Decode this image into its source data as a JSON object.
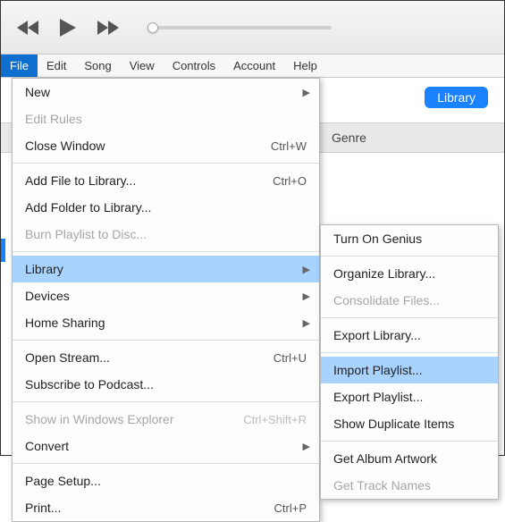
{
  "menubar": {
    "items": [
      "File",
      "Edit",
      "Song",
      "View",
      "Controls",
      "Account",
      "Help"
    ],
    "active_index": 0
  },
  "library_chip": "Library",
  "column_header": "Genre",
  "file_menu": {
    "groups": [
      [
        {
          "label": "New",
          "submenu": true
        },
        {
          "label": "Edit Rules",
          "disabled": true
        },
        {
          "label": "Close Window",
          "shortcut": "Ctrl+W"
        }
      ],
      [
        {
          "label": "Add File to Library...",
          "shortcut": "Ctrl+O"
        },
        {
          "label": "Add Folder to Library..."
        },
        {
          "label": "Burn Playlist to Disc...",
          "disabled": true
        }
      ],
      [
        {
          "label": "Library",
          "submenu": true,
          "highlight": true
        },
        {
          "label": "Devices",
          "submenu": true
        },
        {
          "label": "Home Sharing",
          "submenu": true
        }
      ],
      [
        {
          "label": "Open Stream...",
          "shortcut": "Ctrl+U"
        },
        {
          "label": "Subscribe to Podcast..."
        }
      ],
      [
        {
          "label": "Show in Windows Explorer",
          "shortcut": "Ctrl+Shift+R",
          "disabled": true
        },
        {
          "label": "Convert",
          "submenu": true
        }
      ],
      [
        {
          "label": "Page Setup..."
        },
        {
          "label": "Print...",
          "shortcut": "Ctrl+P"
        }
      ]
    ]
  },
  "library_submenu": {
    "groups": [
      [
        {
          "label": "Turn On Genius"
        }
      ],
      [
        {
          "label": "Organize Library..."
        },
        {
          "label": "Consolidate Files...",
          "disabled": true
        }
      ],
      [
        {
          "label": "Export Library..."
        }
      ],
      [
        {
          "label": "Import Playlist...",
          "highlight": true
        },
        {
          "label": "Export Playlist..."
        },
        {
          "label": "Show Duplicate Items"
        }
      ],
      [
        {
          "label": "Get Album Artwork"
        },
        {
          "label": "Get Track Names",
          "disabled": true
        }
      ]
    ]
  }
}
